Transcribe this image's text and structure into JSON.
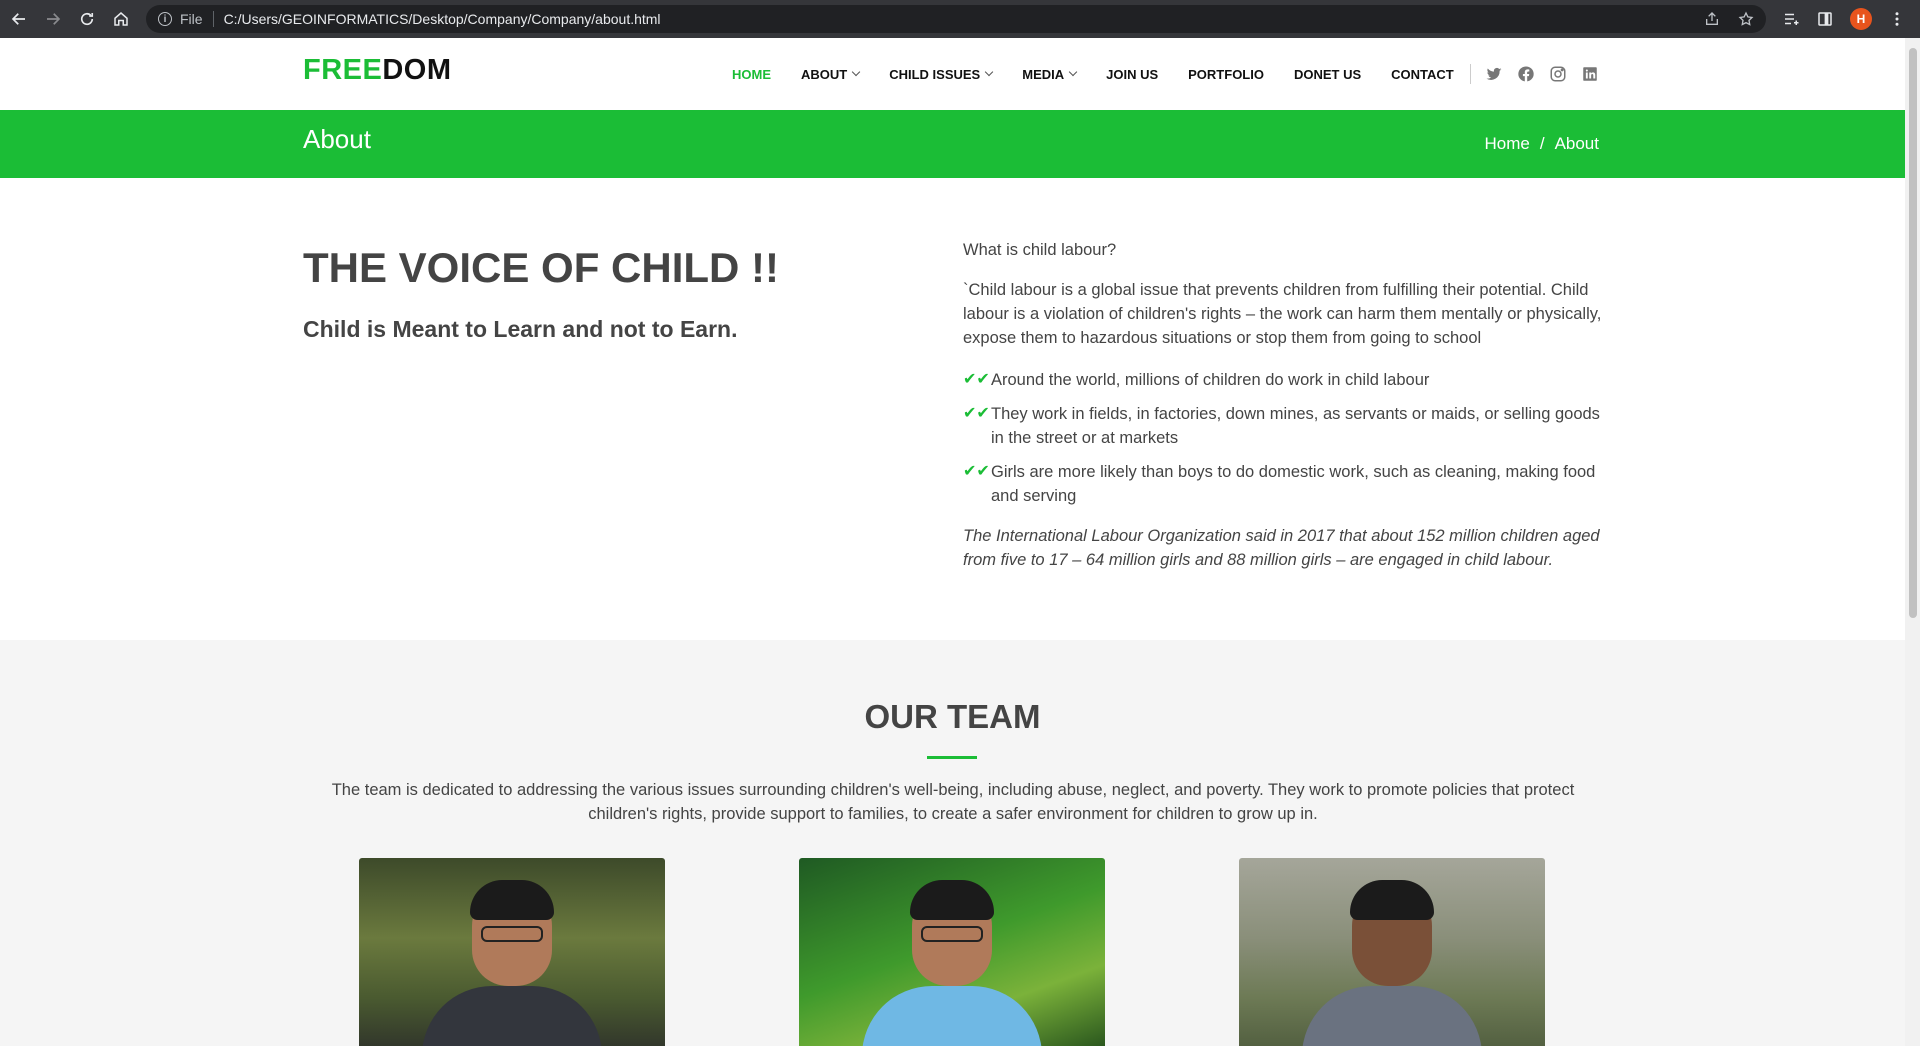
{
  "browser": {
    "protocol": "File",
    "url": "C:/Users/GEOINFORMATICS/Desktop/Company/Company/about.html",
    "avatar_letter": "H"
  },
  "header": {
    "logo_accent": "FREE",
    "logo_rest": "DOM",
    "nav": [
      {
        "label": "HOME",
        "active": true,
        "dropdown": false
      },
      {
        "label": "ABOUT",
        "active": false,
        "dropdown": true
      },
      {
        "label": "CHILD ISSUES",
        "active": false,
        "dropdown": true
      },
      {
        "label": "MEDIA",
        "active": false,
        "dropdown": true
      },
      {
        "label": "JOIN US",
        "active": false,
        "dropdown": false
      },
      {
        "label": "PORTFOLIO",
        "active": false,
        "dropdown": false
      },
      {
        "label": "DONET US",
        "active": false,
        "dropdown": false
      },
      {
        "label": "CONTACT",
        "active": false,
        "dropdown": false
      }
    ],
    "socials": [
      "twitter-icon",
      "facebook-icon",
      "instagram-icon",
      "linkedin-icon"
    ]
  },
  "breadcrumbs": {
    "title": "About",
    "items": [
      "Home",
      "About"
    ],
    "separator": "/"
  },
  "about": {
    "heading": "THE VOICE OF CHILD !!",
    "subheading": "Child is Meant to Learn and not to Earn.",
    "question": "What is child labour?",
    "paragraph": "`Child labour is a global issue that prevents children from fulfilling their potential. Child labour is a violation of children's rights – the work can harm them mentally or physically, expose them to hazardous situations or stop them from going to school",
    "points": [
      "Around the world, millions of children do work in child labour",
      "They work in fields, in factories, down mines, as servants or maids, or selling goods in the street or at markets",
      "Girls are more likely than boys to do domestic work, such as cleaning, making food and serving"
    ],
    "quote": "The International Labour Organization said in 2017 that about 152 million children aged from five to 17 – 64 million girls and 88 million girls – are engaged in child labour."
  },
  "team": {
    "heading": "OUR TEAM",
    "description": "The team is dedicated to addressing the various issues surrounding children's well-being, including abuse, neglect, and poverty. They work to promote policies that protect children's rights, provide support to families, to create a safer environment for children to grow up in."
  },
  "colors": {
    "accent": "#1bbd36",
    "text": "#444444"
  }
}
